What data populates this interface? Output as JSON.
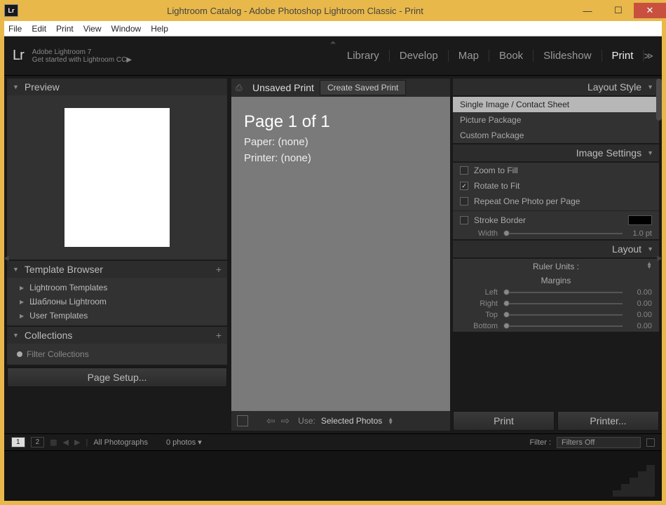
{
  "window": {
    "title": "Lightroom Catalog - Adobe Photoshop Lightroom Classic - Print",
    "app_icon": "Lr"
  },
  "menubar": [
    "File",
    "Edit",
    "Print",
    "View",
    "Window",
    "Help"
  ],
  "header": {
    "logo": "Lr",
    "small_line": "Adobe Lightroom 7",
    "main_line": "Get started with Lightroom CC",
    "modules": [
      "Library",
      "Develop",
      "Map",
      "Book",
      "Slideshow",
      "Print"
    ],
    "active_module": "Print"
  },
  "left": {
    "preview_title": "Preview",
    "template_browser": {
      "title": "Template Browser",
      "items": [
        "Lightroom Templates",
        "Шаблоны Lightroom",
        "User Templates"
      ]
    },
    "collections": {
      "title": "Collections",
      "filter_placeholder": "Filter Collections"
    },
    "page_setup_label": "Page Setup..."
  },
  "center": {
    "unsaved_label": "Unsaved Print",
    "create_saved_label": "Create Saved Print",
    "page_title": "Page 1 of 1",
    "paper_line": "Paper: (none)",
    "printer_line": "Printer: (none)",
    "use_label": "Use:",
    "use_value": "Selected Photos"
  },
  "right": {
    "layout_style": {
      "title": "Layout Style",
      "items": [
        "Single Image / Contact Sheet",
        "Picture Package",
        "Custom Package"
      ],
      "selected": 0
    },
    "image_settings": {
      "title": "Image Settings",
      "zoom_to_fill": {
        "label": "Zoom to Fill",
        "checked": false
      },
      "rotate_to_fit": {
        "label": "Rotate to Fit",
        "checked": true
      },
      "repeat": {
        "label": "Repeat One Photo per Page",
        "checked": false
      },
      "stroke_border": {
        "label": "Stroke Border",
        "checked": false
      },
      "width_label": "Width",
      "width_value": "1.0 pt",
      "stroke_color": "#000000"
    },
    "layout": {
      "title": "Layout",
      "ruler_units_label": "Ruler Units :",
      "margins_label": "Margins",
      "margins": {
        "Left": "0.00",
        "Right": "0.00",
        "Top": "0.00",
        "Bottom": "0.00"
      }
    },
    "print_btn": "Print",
    "printer_btn": "Printer..."
  },
  "filmstrip": {
    "view_1": "1",
    "view_2": "2",
    "source": "All Photographs",
    "count": "0 photos",
    "filter_label": "Filter :",
    "filter_value": "Filters Off"
  }
}
